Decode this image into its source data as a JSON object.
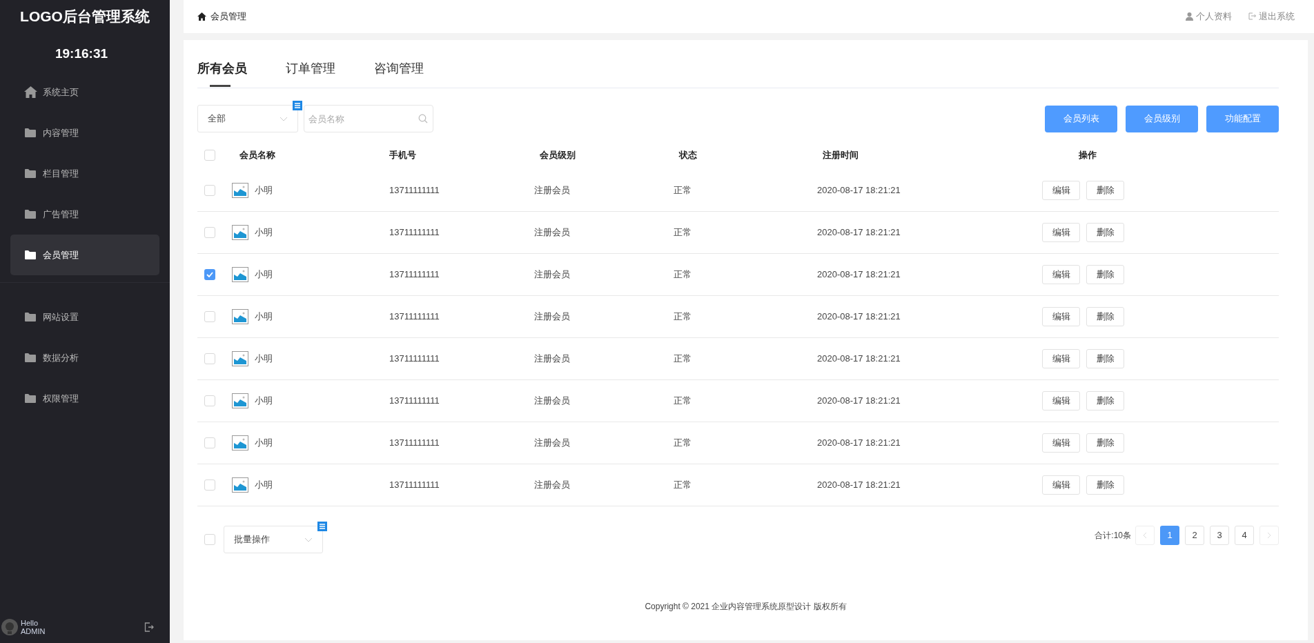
{
  "sidebar": {
    "logo": "LOGO后台管理系统",
    "clock": "19:16:31",
    "groups": [
      [
        {
          "label": "系统主页",
          "kind": "home",
          "selected": false
        },
        {
          "label": "内容管理",
          "kind": "folder",
          "selected": false
        },
        {
          "label": "栏目管理",
          "kind": "folder",
          "selected": false
        },
        {
          "label": "广告管理",
          "kind": "folder",
          "selected": false
        },
        {
          "label": "会员管理",
          "kind": "folder",
          "selected": true
        }
      ],
      [
        {
          "label": "网站设置",
          "kind": "folder",
          "selected": false
        },
        {
          "label": "数据分析",
          "kind": "folder",
          "selected": false
        },
        {
          "label": "权限管理",
          "kind": "folder",
          "selected": false
        }
      ]
    ],
    "user": {
      "greeting": "Hello",
      "name": "ADMIN"
    }
  },
  "topbar": {
    "breadcrumb": "会员管理",
    "links": [
      {
        "label": "个人资料",
        "kind": "profile"
      },
      {
        "label": "退出系统",
        "kind": "logout"
      }
    ]
  },
  "tabs": [
    {
      "label": "所有会员",
      "selected": true
    },
    {
      "label": "订单管理",
      "selected": false
    },
    {
      "label": "咨询管理",
      "selected": false
    }
  ],
  "filter": {
    "select": "全部",
    "search": {
      "placeholder": "会员名称"
    }
  },
  "actions": [
    "会员列表",
    "会员级别",
    "功能配置"
  ],
  "table": {
    "columns": [
      "会员名称",
      "手机号",
      "会员级别",
      "状态",
      "注册时间",
      "操作"
    ],
    "header_checked": false,
    "rows": [
      {
        "checked": false,
        "name": "小明",
        "phone": "13711111111",
        "level": "注册会员",
        "status": "正常",
        "time": "2020-08-17 18:21:21",
        "ops": [
          "编辑",
          "删除"
        ]
      },
      {
        "checked": false,
        "name": "小明",
        "phone": "13711111111",
        "level": "注册会员",
        "status": "正常",
        "time": "2020-08-17 18:21:21",
        "ops": [
          "编辑",
          "删除"
        ]
      },
      {
        "checked": true,
        "name": "小明",
        "phone": "13711111111",
        "level": "注册会员",
        "status": "正常",
        "time": "2020-08-17 18:21:21",
        "ops": [
          "编辑",
          "删除"
        ]
      },
      {
        "checked": false,
        "name": "小明",
        "phone": "13711111111",
        "level": "注册会员",
        "status": "正常",
        "time": "2020-08-17 18:21:21",
        "ops": [
          "编辑",
          "删除"
        ]
      },
      {
        "checked": false,
        "name": "小明",
        "phone": "13711111111",
        "level": "注册会员",
        "status": "正常",
        "time": "2020-08-17 18:21:21",
        "ops": [
          "编辑",
          "删除"
        ]
      },
      {
        "checked": false,
        "name": "小明",
        "phone": "13711111111",
        "level": "注册会员",
        "status": "正常",
        "time": "2020-08-17 18:21:21",
        "ops": [
          "编辑",
          "删除"
        ]
      },
      {
        "checked": false,
        "name": "小明",
        "phone": "13711111111",
        "level": "注册会员",
        "status": "正常",
        "time": "2020-08-17 18:21:21",
        "ops": [
          "编辑",
          "删除"
        ]
      },
      {
        "checked": false,
        "name": "小明",
        "phone": "13711111111",
        "level": "注册会员",
        "status": "正常",
        "time": "2020-08-17 18:21:21",
        "ops": [
          "编辑",
          "删除"
        ]
      }
    ]
  },
  "footer": {
    "select_all_checked": false,
    "bulk": "批量操作",
    "total": "合计:10条",
    "pages": [
      {
        "label": "1",
        "selected": true
      },
      {
        "label": "2",
        "selected": false
      },
      {
        "label": "3",
        "selected": false
      },
      {
        "label": "4",
        "selected": false
      }
    ]
  },
  "copyright": "Copyright © 2021 企业内容管理系统原型设计 版权所有"
}
